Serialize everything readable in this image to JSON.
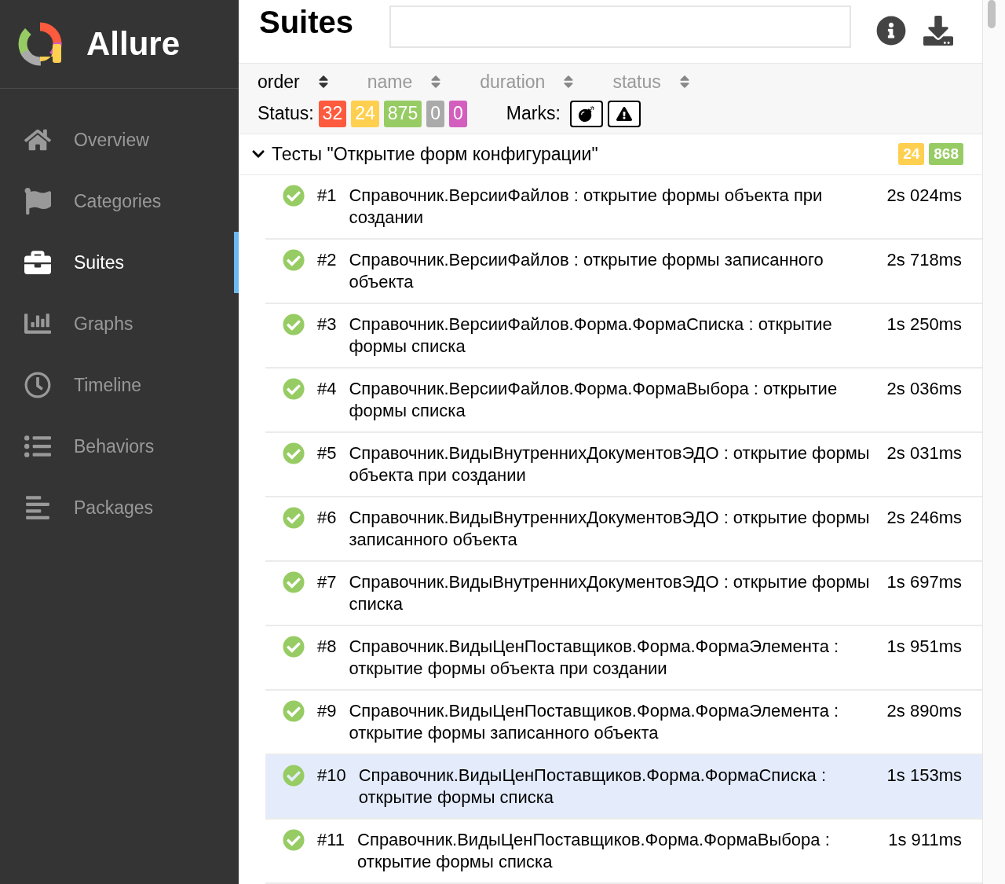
{
  "sidebar": {
    "brand": "Allure",
    "items": [
      {
        "label": "Overview",
        "selected": false
      },
      {
        "label": "Categories",
        "selected": false
      },
      {
        "label": "Suites",
        "selected": true
      },
      {
        "label": "Graphs",
        "selected": false
      },
      {
        "label": "Timeline",
        "selected": false
      },
      {
        "label": "Behaviors",
        "selected": false
      },
      {
        "label": "Packages",
        "selected": false
      }
    ]
  },
  "header": {
    "title": "Suites"
  },
  "sorters": [
    {
      "label": "order",
      "selected": true
    },
    {
      "label": "name",
      "selected": false
    },
    {
      "label": "duration",
      "selected": false
    },
    {
      "label": "status",
      "selected": false
    }
  ],
  "status_filter": {
    "label": "Status:",
    "badges": [
      {
        "count": "32",
        "color": "#fd5a3e"
      },
      {
        "count": "24",
        "color": "#ffd050"
      },
      {
        "count": "875",
        "color": "#97cc64"
      },
      {
        "count": "0",
        "color": "#aaaaaa"
      },
      {
        "count": "0",
        "color": "#d35ebe"
      }
    ]
  },
  "marks_filter": {
    "label": "Marks:",
    "marks": [
      {
        "kind": "flaky",
        "selected": false
      },
      {
        "kind": "warning",
        "selected": false
      }
    ]
  },
  "group": {
    "title": "Тесты \"Открытие форм конфигурации\"",
    "expanded": true,
    "badges": [
      {
        "count": "24",
        "color": "#ffd050"
      },
      {
        "count": "868",
        "color": "#97cc64"
      }
    ]
  },
  "rows": [
    {
      "number": "#1",
      "name": "Справочник.ВерсииФайлов : открытие формы объекта при создании",
      "duration": "2s 024ms",
      "selected": false
    },
    {
      "number": "#2",
      "name": "Справочник.ВерсииФайлов : открытие формы записанного объекта",
      "duration": "2s 718ms",
      "selected": false
    },
    {
      "number": "#3",
      "name": "Справочник.ВерсииФайлов.Форма.ФормаСписка : открытие формы списка",
      "duration": "1s 250ms",
      "selected": false
    },
    {
      "number": "#4",
      "name": "Справочник.ВерсииФайлов.Форма.ФормаВыбора : открытие формы списка",
      "duration": "2s 036ms",
      "selected": false
    },
    {
      "number": "#5",
      "name": "Справочник.ВидыВнутреннихДокументовЭДО : открытие формы объекта при создании",
      "duration": "2s 031ms",
      "selected": false
    },
    {
      "number": "#6",
      "name": "Справочник.ВидыВнутреннихДокументовЭДО : открытие формы записанного объекта",
      "duration": "2s 246ms",
      "selected": false
    },
    {
      "number": "#7",
      "name": "Справочник.ВидыВнутреннихДокументовЭДО : открытие формы списка",
      "duration": "1s 697ms",
      "selected": false
    },
    {
      "number": "#8",
      "name": "Справочник.ВидыЦенПоставщиков.Форма.ФормаЭлемента : открытие формы объекта при создании",
      "duration": "1s 951ms",
      "selected": false
    },
    {
      "number": "#9",
      "name": "Справочник.ВидыЦенПоставщиков.Форма.ФормаЭлемента : открытие формы записанного объекта",
      "duration": "2s 890ms",
      "selected": false
    },
    {
      "number": "#10",
      "name": "Справочник.ВидыЦенПоставщиков.Форма.ФормаСписка : открытие формы списка",
      "duration": "1s 153ms",
      "selected": true
    },
    {
      "number": "#11",
      "name": "Справочник.ВидыЦенПоставщиков.Форма.ФормаВыбора : открытие формы списка",
      "duration": "1s 911ms",
      "selected": false
    }
  ]
}
